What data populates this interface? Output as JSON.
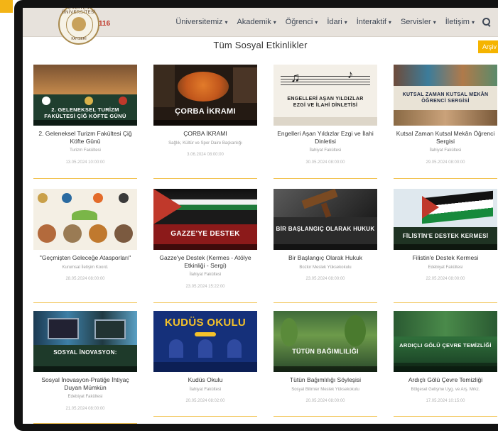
{
  "header": {
    "logo_top_text": "ERCİYES ÜNİVERSİTESİ",
    "logo_bottom_text": "KAYSERİ",
    "logo_badge": "116"
  },
  "nav": {
    "items": [
      {
        "label": "Üniversitemiz"
      },
      {
        "label": "Akademik"
      },
      {
        "label": "Öğrenci"
      },
      {
        "label": "İdari"
      },
      {
        "label": "İnteraktif"
      },
      {
        "label": "Servisler"
      },
      {
        "label": "İletişim"
      }
    ],
    "caret": "▾",
    "search_icon": "search-icon"
  },
  "page": {
    "title": "Tüm Sosyal Etkinlikler",
    "archive_label": "Arşiv"
  },
  "events": [
    {
      "banner": "2. GELENEKSEL TURİZM FAKÜLTESİ ÇİĞ KÖFTE GÜNÜ",
      "title": "2. Geleneksel Turizm Fakültesi Çiğ Köfte Günü",
      "unit": "Turizm Fakültesi",
      "date": "13.05.2024 10:00:00"
    },
    {
      "banner": "ÇORBA İKRAMI",
      "title": "ÇORBA İKRAMI",
      "unit": "Sağlık, Kültür ve Spor Daire Başkanlığı",
      "date": "3.06.2024 08:00:00"
    },
    {
      "banner": "ENGELLERİ AŞAN YILDIZLAR EZGİ VE İLAHİ DİNLETİSİ",
      "title": "Engelleri Aşan Yıldızlar Ezgi ve İlahi Dinletisi",
      "unit": "İlahiyat Fakültesi",
      "date": "30.05.2024 08:00:00"
    },
    {
      "banner": "KUTSAL ZAMAN KUTSAL MEKÂN ÖĞRENCİ SERGİSİ",
      "title": "Kutsal Zaman Kutsal Mekân Öğrenci Sergisi",
      "unit": "İlahiyat Fakültesi",
      "date": "29.05.2024 08:00:00"
    },
    {
      "banner": "",
      "title": "\"Geçmişten Geleceğe Atasporları\"",
      "unit": "Kurumsal İletişim Koord.",
      "date": "28.05.2024 08:00:00"
    },
    {
      "banner": "GAZZE'YE DESTEK",
      "title": "Gazze'ye Destek (Kermes - Atölye Etkinliği - Sergi)",
      "unit": "İlahiyat Fakültesi",
      "date": "23.05.2024 15:22:00"
    },
    {
      "banner": "BİR BAŞLANGIÇ OLARAK HUKUK",
      "title": "Bir Başlangıç Olarak Hukuk",
      "unit": "Bozkır Meslek Yüksekokulu",
      "date": "23.05.2024 08:00:00"
    },
    {
      "banner": "FİLİSTİN'E DESTEK KERMESİ",
      "title": "Filistin'e Destek Kermesi",
      "unit": "Edebiyat Fakültesi",
      "date": "22.05.2024 08:00:00"
    },
    {
      "banner": "SOSYAL İNOVASYON:",
      "title": "Sosyal İnovasyon-Pratiğe İhtiyaç Duyan Mümkün",
      "unit": "Edebiyat Fakültesi",
      "date": "21.05.2024 08:00:00"
    },
    {
      "banner": "KUDÜS OKULU",
      "title": "Kudüs Okulu",
      "unit": "İlahiyat Fakültesi",
      "date": "20.05.2024 08:02:00"
    },
    {
      "banner": "TÜTÜN BAĞIMLILIĞI",
      "title": "Tütün Bağımlılığı Söyleşisi",
      "unit": "Sosyal Bilimler Meslek Yüksekokulu",
      "date": "20.05.2024 08:00:00"
    },
    {
      "banner": "ARDIÇLI GÖLÜ ÇEVRE TEMİZLİĞİ",
      "title": "Ardıçlı Gölü Çevre Temizliği",
      "unit": "Bölgesel Gelişme Uyg. ve Arş. Mrkz.",
      "date": "17.05.2024 10:15:00"
    }
  ],
  "colors": {
    "accent": "#f5b400",
    "nav_bg": "#e7e2dc",
    "frame": "#121212"
  }
}
